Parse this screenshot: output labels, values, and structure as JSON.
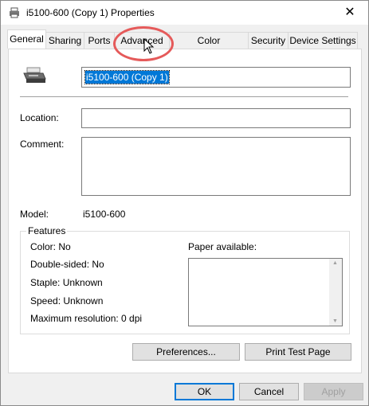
{
  "window": {
    "title": "i5100-600 (Copy 1) Properties",
    "close_glyph": "✕"
  },
  "tabs": [
    {
      "label": "General",
      "active": true
    },
    {
      "label": "Sharing"
    },
    {
      "label": "Ports"
    },
    {
      "label": "Advanced"
    },
    {
      "label": "Color Management"
    },
    {
      "label": "Security"
    },
    {
      "label": "Device Settings"
    }
  ],
  "general": {
    "printer_name": "i5100-600 (Copy 1)",
    "location_label": "Location:",
    "location_value": "",
    "comment_label": "Comment:",
    "comment_value": "",
    "model_label": "Model:",
    "model_value": "i5100-600"
  },
  "features": {
    "title": "Features",
    "color": "Color: No",
    "double_sided": "Double-sided: No",
    "staple": "Staple: Unknown",
    "speed": "Speed: Unknown",
    "max_resolution": "Maximum resolution: 0 dpi",
    "paper_label": "Paper available:"
  },
  "buttons": {
    "preferences": "Preferences...",
    "print_test": "Print Test Page",
    "ok": "OK",
    "cancel": "Cancel",
    "apply": "Apply"
  },
  "icons": {
    "printer": "printer-icon",
    "close": "close-icon",
    "cursor": "mouse-pointer-icon"
  },
  "colors": {
    "selection": "#0078d7",
    "annotation": "#e55a5a"
  }
}
